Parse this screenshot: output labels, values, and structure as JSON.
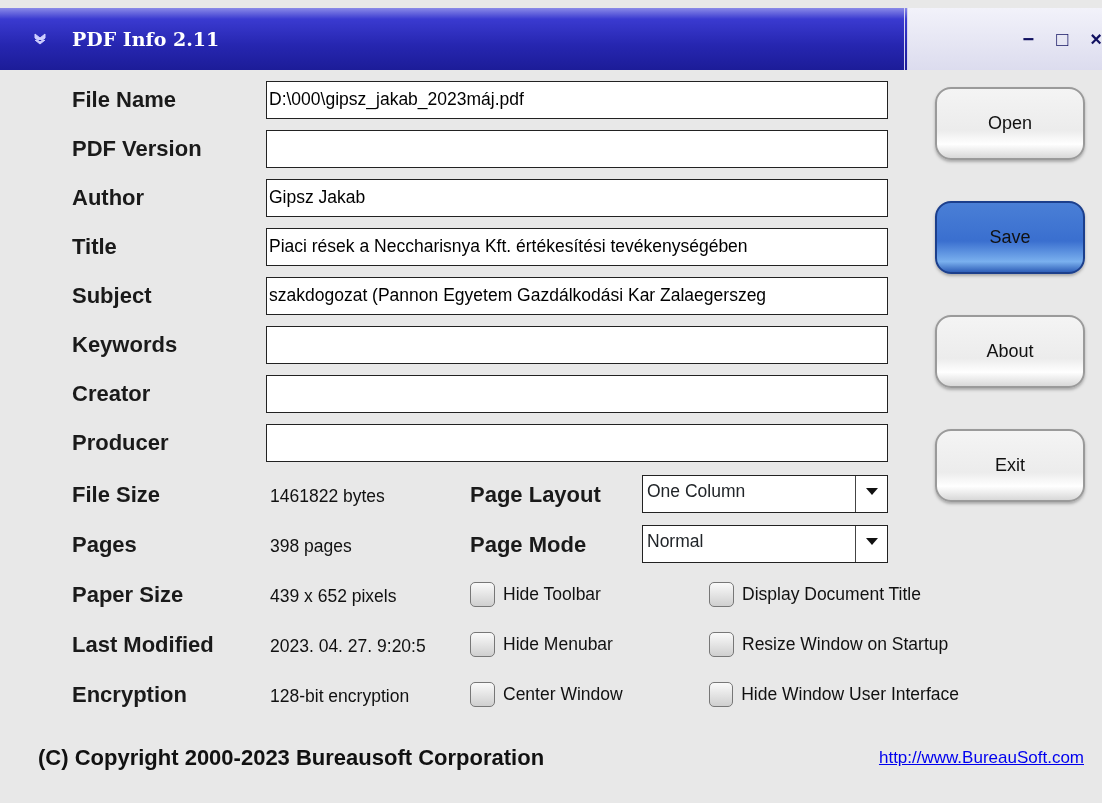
{
  "window": {
    "title": "PDF Info 2.11",
    "controls": [
      "−",
      "□",
      "×"
    ]
  },
  "fields": [
    {
      "label": "File Name",
      "value": "D:\\000\\gipsz_jakab_2023máj.pdf"
    },
    {
      "label": "PDF Version"
    },
    {
      "label": "Author",
      "value": "Gipsz Jakab"
    },
    {
      "label": "Title",
      "value": "Piaci rések a Neccharisnya Kft. értékesítési tevékenységében"
    },
    {
      "label": "Subject",
      "value": "szakdogozat (Pannon Egyetem Gazdálkodási Kar Zalaegerszeg"
    },
    {
      "label": "Keywords"
    },
    {
      "label": "Creator"
    },
    {
      "label": "Producer"
    }
  ],
  "buttons": [
    {
      "label": "Open",
      "focused": false
    },
    {
      "label": "Save",
      "focused": true
    },
    {
      "label": "About",
      "focused": false
    },
    {
      "label": "Exit",
      "focused": false
    }
  ],
  "info": [
    {
      "label": "File Size",
      "value": "1461822 bytes"
    },
    {
      "label": "Pages",
      "value": "398 pages"
    },
    {
      "label": "Paper Size",
      "value": "439 x 652 pixels"
    },
    {
      "label": "Last Modified",
      "value": "2023. 04. 27. 9:20:5"
    },
    {
      "label": "Encryption",
      "value": "128-bit encryption"
    }
  ],
  "dropdowns": [
    {
      "label": "Page Layout",
      "value": "One Column"
    },
    {
      "label": "Page Mode",
      "value": "Normal"
    }
  ],
  "checkboxes": [
    {
      "label": "Hide Toolbar",
      "checked": false
    },
    {
      "label": "Display Document Title",
      "checked": false
    },
    {
      "label": "Hide Menubar",
      "checked": false
    },
    {
      "label": "Resize Window on Startup",
      "checked": false
    },
    {
      "label": "Center Window",
      "checked": false
    },
    {
      "label": "Hide Window User Interface",
      "checked": false
    }
  ],
  "footer": {
    "copyright": "(C) Copyright 2000-2023 Bureausoft Corporation",
    "link": "http://www.BureauSoft.com"
  }
}
